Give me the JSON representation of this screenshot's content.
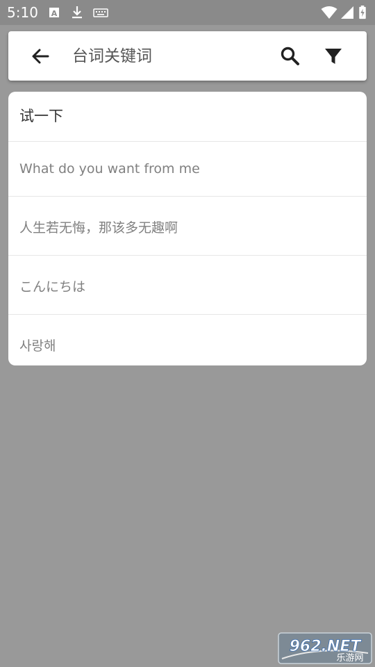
{
  "status_bar": {
    "time": "5:10"
  },
  "search": {
    "placeholder": "台词关键词",
    "back_icon": "arrow-back-icon",
    "search_icon": "search-icon",
    "filter_icon": "filter-icon"
  },
  "suggestions": [
    {
      "text": "试一下"
    },
    {
      "text": "What do you want from me"
    },
    {
      "text": "人生若无悔，那该多无趣啊"
    },
    {
      "text": "こんにちは"
    },
    {
      "text": "사랑해"
    }
  ],
  "watermark": {
    "main": "962.NET",
    "sub": "乐游网"
  },
  "colors": {
    "background": "#999999",
    "status_bar": "#8a8a8a",
    "card": "#ffffff",
    "primary_text": "#333333",
    "secondary_text": "#808080"
  }
}
